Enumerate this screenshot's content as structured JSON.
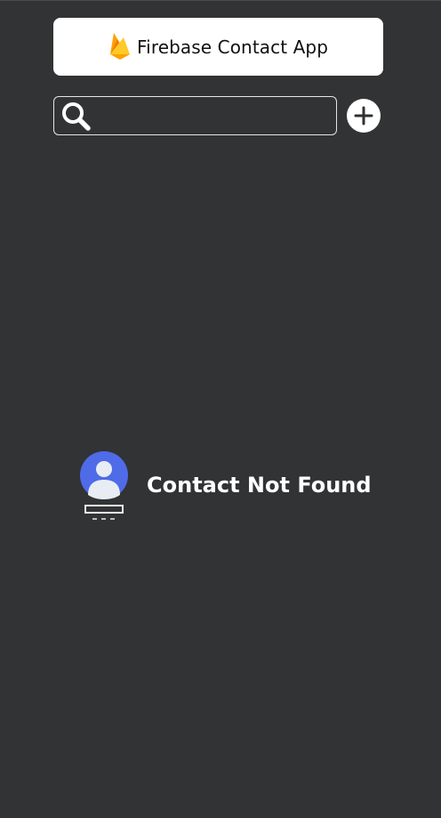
{
  "header": {
    "title": "Firebase Contact App",
    "logo_icon": "firebase-flame-icon"
  },
  "search": {
    "value": "",
    "placeholder": "",
    "icon": "search-icon"
  },
  "add_button": {
    "icon": "plus-icon"
  },
  "empty_state": {
    "message": "Contact Not Found",
    "icon": "user-avatar-not-found-icon"
  },
  "colors": {
    "background": "#323334",
    "surface": "#ffffff",
    "accent_avatar": "#4f6be8",
    "flame_yellow": "#ffca28",
    "flame_orange": "#f5a623",
    "flame_dark": "#e65100"
  }
}
